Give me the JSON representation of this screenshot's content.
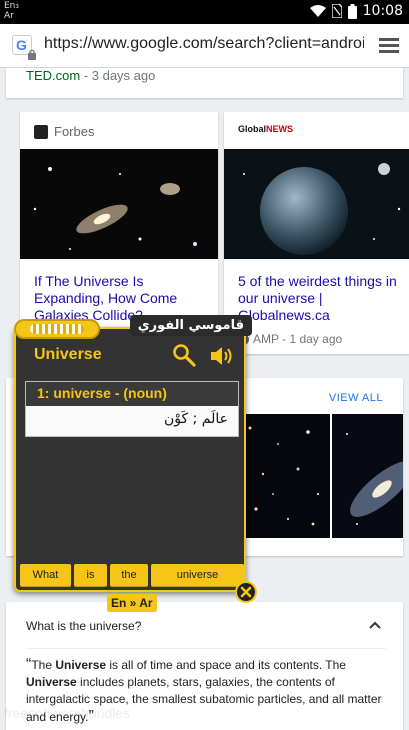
{
  "status_bar": {
    "ime": "En₃\nAr",
    "time": "10:08"
  },
  "browser": {
    "url": "https://www.google.com/search?client=androi"
  },
  "top_result": {
    "source": "TED.com",
    "time": "3 days ago"
  },
  "stories": [
    {
      "source": "Forbes",
      "title": "If The Universe Is Expanding, How Come Galaxies Collide?"
    },
    {
      "source": "Global News",
      "title": "5 of the weirdest things in our universe | Globalnews.ca",
      "meta": "AMP - 1 day ago"
    }
  ],
  "images_section": {
    "view_all": "VIEW ALL"
  },
  "faq": {
    "question": "What is the universe?",
    "answer_parts": [
      "The ",
      "Universe",
      " is all of time and space and its contents. The ",
      "Universe",
      " includes planets, stars, galaxies, the contents of intergalactic space, the smallest subatomic particles, and all matter and energy."
    ],
    "open_quote": "“",
    "close_quote": "”"
  },
  "dictionary": {
    "brand": "قاموسي الفوري",
    "word": "Universe",
    "entry_head": "1:  universe - (noun)",
    "entry_translation": "عالَم ; كَوْن",
    "chips": [
      "What",
      "is",
      "the",
      "universe"
    ],
    "lang_pair": "En » Ar",
    "accent": "#f5c518"
  },
  "watermark": "freesoftwarebundles"
}
